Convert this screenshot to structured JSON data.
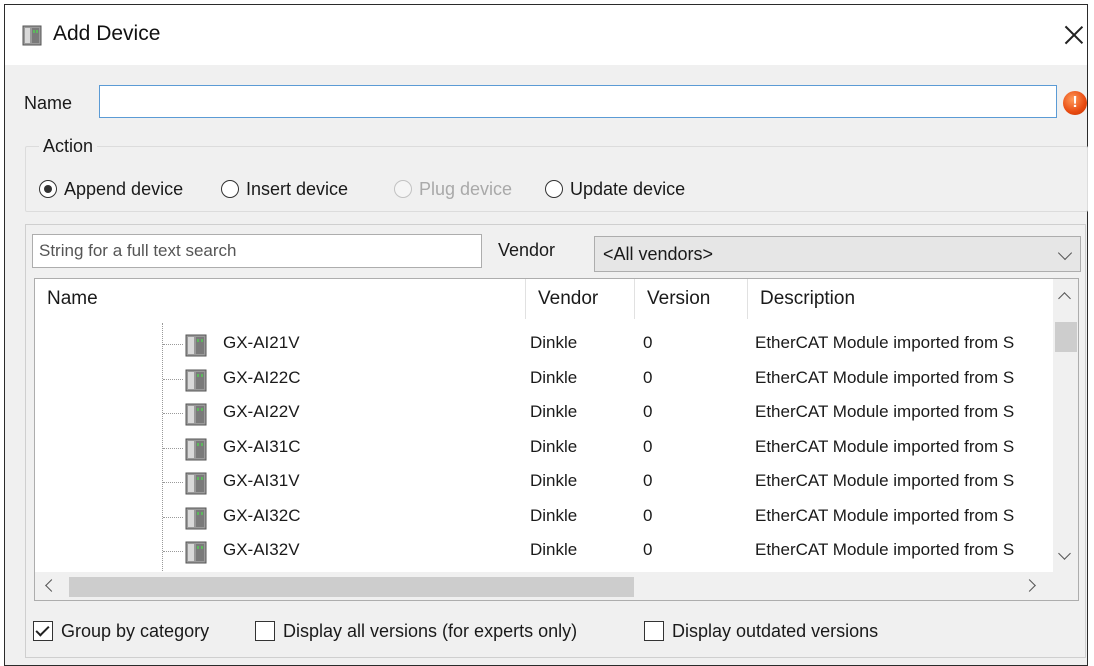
{
  "window": {
    "title": "Add Device",
    "icon": "device-module-icon",
    "close_icon": "close-icon"
  },
  "name_field": {
    "label": "Name",
    "value": "",
    "status_icon": "error-icon",
    "status_glyph": "!"
  },
  "action": {
    "legend": "Action",
    "options": [
      {
        "label": "Append device",
        "selected": true,
        "enabled": true
      },
      {
        "label": "Insert device",
        "selected": false,
        "enabled": true
      },
      {
        "label": "Plug device",
        "selected": false,
        "enabled": false
      },
      {
        "label": "Update device",
        "selected": false,
        "enabled": true
      }
    ]
  },
  "filter": {
    "search_placeholder": "String for a full text search",
    "vendor_label": "Vendor",
    "vendor_selected": "<All vendors>"
  },
  "table": {
    "columns": [
      "Name",
      "Vendor",
      "Version",
      "Description"
    ],
    "rows": [
      {
        "name": "GX-AI21V",
        "vendor": "Dinkle",
        "version": "0",
        "description": "EtherCAT Module imported from S"
      },
      {
        "name": "GX-AI22C",
        "vendor": "Dinkle",
        "version": "0",
        "description": "EtherCAT Module imported from S"
      },
      {
        "name": "GX-AI22V",
        "vendor": "Dinkle",
        "version": "0",
        "description": "EtherCAT Module imported from S"
      },
      {
        "name": "GX-AI31C",
        "vendor": "Dinkle",
        "version": "0",
        "description": "EtherCAT Module imported from S"
      },
      {
        "name": "GX-AI31V",
        "vendor": "Dinkle",
        "version": "0",
        "description": "EtherCAT Module imported from S"
      },
      {
        "name": "GX-AI32C",
        "vendor": "Dinkle",
        "version": "0",
        "description": "EtherCAT Module imported from S"
      },
      {
        "name": "GX-AI32V",
        "vendor": "Dinkle",
        "version": "0",
        "description": "EtherCAT Module imported from S"
      }
    ]
  },
  "options": {
    "group_by_category": {
      "label": "Group by category",
      "checked": true
    },
    "display_all_versions": {
      "label": "Display all versions (for experts only)",
      "checked": false
    },
    "display_outdated": {
      "label": "Display outdated versions",
      "checked": false
    }
  },
  "colors": {
    "error": "#e84a10",
    "focus_border": "#5b9bd5",
    "disabled_text": "#a9a9a9"
  }
}
